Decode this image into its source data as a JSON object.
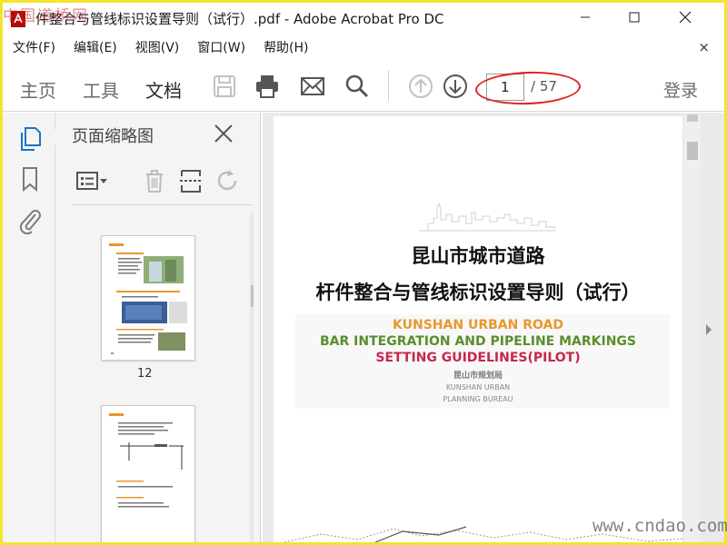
{
  "watermark_top": "中国道桥网",
  "watermark_bottom": "www.cndao.com",
  "window": {
    "title": "件整合与管线标识设置导则（试行）.pdf - Adobe Acrobat Pro DC"
  },
  "menu": {
    "items": [
      "文件(F)",
      "编辑(E)",
      "视图(V)",
      "窗口(W)",
      "帮助(H)"
    ],
    "close_glyph": "×"
  },
  "toolbar": {
    "tabs": [
      {
        "label": "主页",
        "active": false
      },
      {
        "label": "工具",
        "active": false
      },
      {
        "label": "文档",
        "active": true
      }
    ],
    "icons": [
      "save-icon",
      "print-icon",
      "email-icon",
      "search-icon",
      "prev-page-icon",
      "next-page-icon"
    ],
    "page_current": "1",
    "page_total": "/ 57",
    "login": "登录"
  },
  "left_rail": {
    "icons": [
      "page-thumbnails-icon",
      "bookmark-icon",
      "attachment-icon"
    ]
  },
  "thumb_panel": {
    "title": "页面缩略图",
    "tools": [
      "thumbnail-options-icon",
      "delete-page-icon",
      "extract-page-icon",
      "rotate-page-icon"
    ],
    "pages": [
      {
        "label": "12"
      }
    ]
  },
  "document": {
    "cn_title_line1": "昆山市城市道路",
    "cn_title_line2": "杆件整合与管线标识设置导则（试行）",
    "en_line1": "KUNSHAN URBAN ROAD",
    "en_line2": "BAR INTEGRATION AND PIPELINE MARKINGS",
    "en_line3": "SETTING GUIDELINES(PILOT)",
    "bureau_cn": "昆山市规划局",
    "bureau_en1": "KUNSHAN URBAN",
    "bureau_en2": "PLANNING BUREAU",
    "colors": {
      "en_line1": "#e8972e",
      "en_line2": "#5a8e2c",
      "en_line3": "#c6284f"
    }
  },
  "annotation": {
    "color": "#e02020"
  }
}
